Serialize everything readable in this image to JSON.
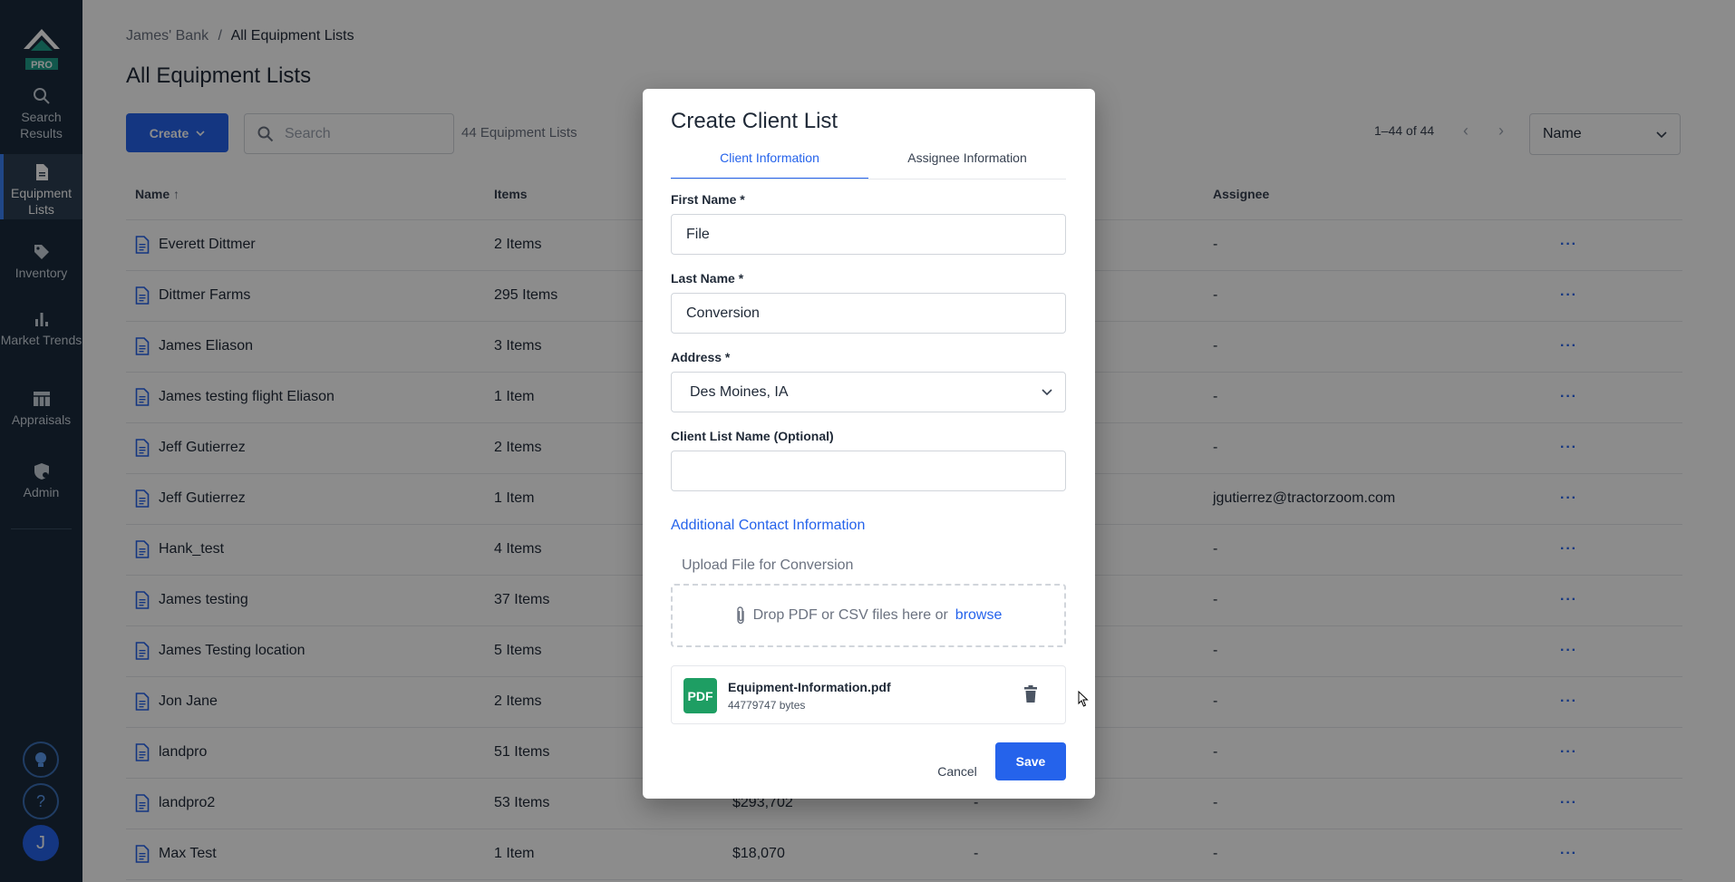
{
  "sidebar": {
    "logo_badge": "PRO",
    "items": [
      {
        "label": "Search Results",
        "icon": "search-icon"
      },
      {
        "label": "Equipment Lists",
        "icon": "document-icon"
      },
      {
        "label": "Inventory",
        "icon": "tag-icon"
      },
      {
        "label": "Market Trends",
        "icon": "bar-chart-icon"
      },
      {
        "label": "Appraisals",
        "icon": "table-icon"
      },
      {
        "label": "Admin",
        "icon": "shield-icon"
      }
    ],
    "avatar_initial": "J",
    "help_glyph": "?"
  },
  "breadcrumb": {
    "parent": "James' Bank",
    "separator": "/",
    "current": "All Equipment Lists"
  },
  "page_title": "All Equipment Lists",
  "toolbar": {
    "create_label": "Create",
    "search_placeholder": "Search",
    "list_count": "44 Equipment Lists",
    "pagination": "1–44 of 44",
    "sort_value": "Name"
  },
  "table": {
    "headers": {
      "name": "Name",
      "items": "Items",
      "assignee": "Assignee"
    },
    "rows": [
      {
        "name": "Everett Dittmer",
        "items": "2 Items",
        "value": "",
        "location": "",
        "assignee": "-"
      },
      {
        "name": "Dittmer Farms",
        "items": "295 Items",
        "value": "",
        "location": "",
        "assignee": "-"
      },
      {
        "name": "James Eliason",
        "items": "3 Items",
        "value": "",
        "location": "",
        "assignee": "-"
      },
      {
        "name": "James testing flight Eliason",
        "items": "1 Item",
        "value": "",
        "location": "",
        "assignee": "-"
      },
      {
        "name": "Jeff Gutierrez",
        "items": "2 Items",
        "value": "",
        "location": "",
        "assignee": "-"
      },
      {
        "name": "Jeff Gutierrez",
        "items": "1 Item",
        "value": "",
        "location": "",
        "assignee": "jgutierrez@tractorzoom.com"
      },
      {
        "name": "Hank_test",
        "items": "4 Items",
        "value": "",
        "location": "",
        "assignee": "-"
      },
      {
        "name": "James testing",
        "items": "37 Items",
        "value": "",
        "location": "",
        "assignee": "-"
      },
      {
        "name": "James Testing location",
        "items": "5 Items",
        "value": "",
        "location": "",
        "assignee": "-"
      },
      {
        "name": "Jon Jane",
        "items": "2 Items",
        "value": "",
        "location": "",
        "assignee": "-"
      },
      {
        "name": "landpro",
        "items": "51 Items",
        "value": "",
        "location": "",
        "assignee": "-"
      },
      {
        "name": "landpro2",
        "items": "53 Items",
        "value": "$293,702",
        "location": "-",
        "assignee": "-"
      },
      {
        "name": "Max Test",
        "items": "1 Item",
        "value": "$18,070",
        "location": "-",
        "assignee": "-"
      }
    ],
    "more_glyph": "···"
  },
  "modal": {
    "title": "Create Client List",
    "tabs": [
      "Client Information",
      "Assignee Information"
    ],
    "first_name_label": "First Name *",
    "first_name_value": "File",
    "last_name_label": "Last Name *",
    "last_name_value": "Conversion",
    "address_label": "Address *",
    "address_value": "Des Moines, IA",
    "client_list_name_label": "Client List Name (Optional)",
    "client_list_name_value": "",
    "additional_contact": "Additional Contact Information",
    "upload_label": "Upload File for Conversion",
    "dropzone_text": "Drop PDF or CSV files here or",
    "browse_label": "browse",
    "file": {
      "badge": "PDF",
      "name": "Equipment-Information.pdf",
      "size": "44779747 bytes"
    },
    "cancel_label": "Cancel",
    "save_label": "Save"
  },
  "colors": {
    "accent": "#2563eb",
    "sidebar": "#1b2b3d",
    "pdf_badge": "#1e9e63"
  }
}
